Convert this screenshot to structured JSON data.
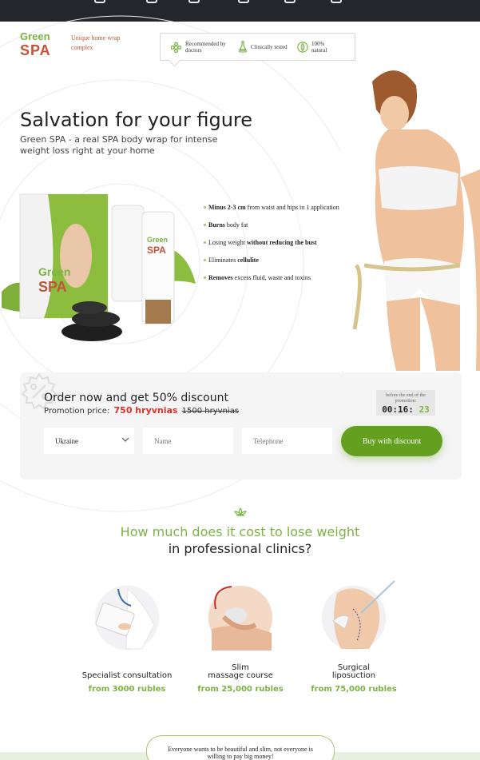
{
  "header": {
    "logo_line1": "Green",
    "logo_line2": "SPA",
    "tagline": "Unique home wrap complex",
    "badges": [
      {
        "icon": "flower-icon",
        "label": "Recommended by doctors"
      },
      {
        "icon": "flask-icon",
        "label": "Clinically tested"
      },
      {
        "icon": "leaf-icon",
        "label": "100% natural"
      }
    ]
  },
  "hero": {
    "title": "Salvation for your figure",
    "subtitle": "Green SPA - a real SPA body wrap for intense weight loss right at your home",
    "benefits": [
      {
        "bold": "Minus 2-3 cm",
        "rest": " from waist and hips in 1 application"
      },
      {
        "bold": "Burns",
        "rest": " body fat"
      },
      {
        "pre": "Losing weight ",
        "bold": "without reducing the bust"
      },
      {
        "pre": "Eliminates ",
        "bold": "cellulite"
      },
      {
        "bold": "Removes",
        "rest": " excess fluid, waste and toxins"
      }
    ]
  },
  "order": {
    "title": "Order now and get 50% discount",
    "price_label": "Promotion price:",
    "new_price": "750 hryvnias",
    "old_price": "1500 hryvnias",
    "timer_caption": "before the end of the promotion:",
    "timer_hm": "00:16:",
    "timer_s": "23",
    "country": "Ukraine",
    "name_placeholder": "Name",
    "phone_placeholder": "Telephone",
    "buy_label": "Buy with discount"
  },
  "costs": {
    "question_line1": "How much does it cost to lose weight",
    "question_line2": "in professional clinics?",
    "services": [
      {
        "name_line1": "Specialist consultation",
        "name_line2": "",
        "price": "from 3000 rubles"
      },
      {
        "name_line1": "Slim",
        "name_line2": "massage course",
        "price": "from 25,000 rubles"
      },
      {
        "name_line1": "Surgical",
        "name_line2": "liposuction",
        "price": "from 75,000 rubles"
      }
    ]
  },
  "footer_bubble": "Everyone wants to be beautiful and slim, not everyone is willing to pay big money!",
  "colors": {
    "accent_green": "#7cb342",
    "brand_red": "#c1543a",
    "price_red": "#e0302b",
    "button_green": "#63a01f"
  }
}
